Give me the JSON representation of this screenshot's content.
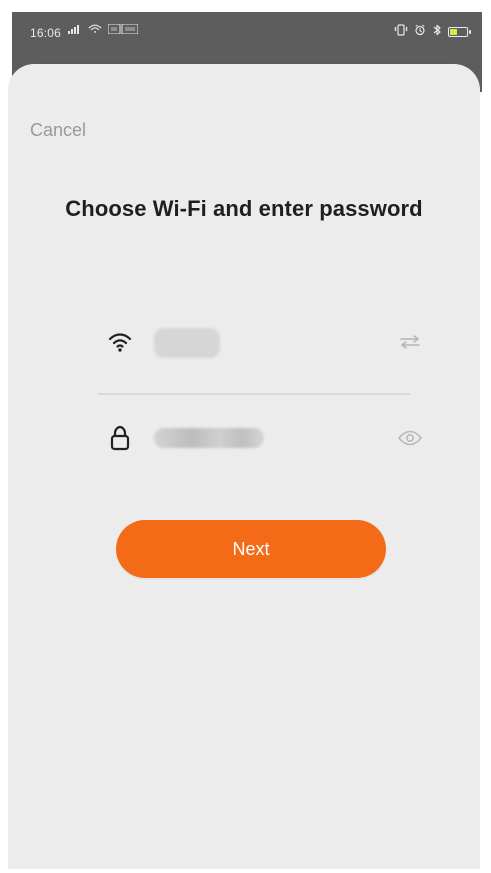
{
  "status_bar": {
    "time": "16:06",
    "left_icons": [
      "signal-icon",
      "wifi-status-icon",
      "volte-hd-icon"
    ],
    "right_icons": [
      "vibrate-icon",
      "alarm-icon",
      "bluetooth-icon",
      "battery-icon"
    ]
  },
  "dialog": {
    "cancel_label": "Cancel",
    "title": "Choose Wi‑Fi and enter password",
    "wifi_field": {
      "left_icon": "wifi-icon",
      "right_icon": "swap-icon"
    },
    "password_field": {
      "left_icon": "lock-icon",
      "right_icon": "eye-icon"
    },
    "next_label": "Next"
  },
  "colors": {
    "statusbar_bg": "#5d5d5d",
    "sheet_bg": "#ececec",
    "accent_orange": "#f36b17",
    "text_dark": "#1f1f1f",
    "text_muted": "#9a9a9a"
  }
}
